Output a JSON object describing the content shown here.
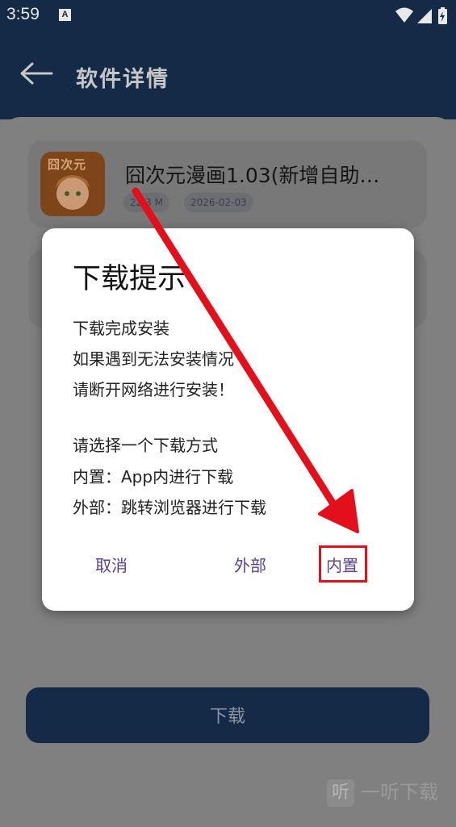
{
  "status_bar": {
    "time": "3:59",
    "notification_icon": "A"
  },
  "header": {
    "title": "软件详情"
  },
  "app": {
    "name": "囧次元漫画1.03(新增自助…",
    "icon_text": "囧次元",
    "size": "22.3 M",
    "date": "2026-02-03"
  },
  "dialog": {
    "title": "下载提示",
    "lines": [
      "下载完成安装",
      "如果遇到无法安装情况",
      "请断开网络进行安装！",
      "请选择一个下载方式",
      "内置：App内进行下载",
      "外部：跳转浏览器进行下载"
    ],
    "buttons": {
      "cancel": "取消",
      "external": "外部",
      "builtin": "内置"
    }
  },
  "download_button": "下载",
  "watermark": {
    "icon": "听",
    "text": "一听下载"
  },
  "colors": {
    "accent": "#5a4099",
    "header": "#1f3a64",
    "arrow": "#e3101b"
  }
}
